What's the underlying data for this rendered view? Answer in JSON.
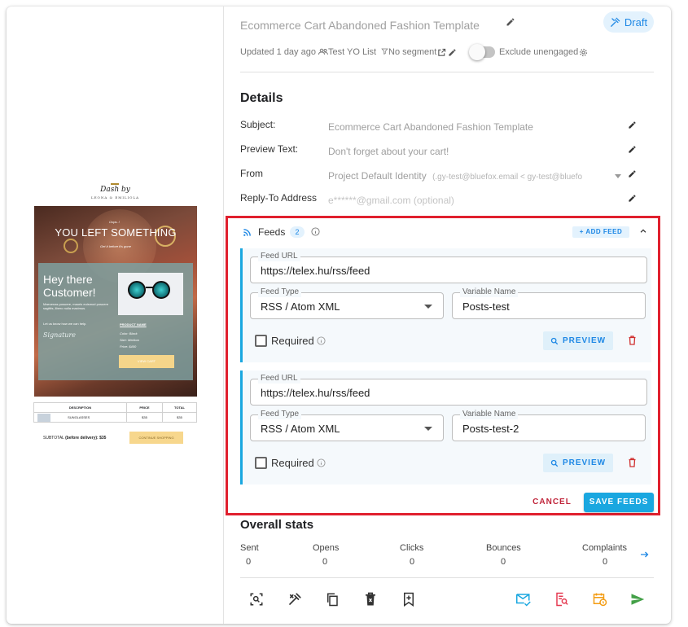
{
  "campaign": {
    "title": "Ecommerce Cart Abandoned Fashion Template",
    "status": "Draft",
    "updated": "Updated 1 day ago",
    "list": "Test YO List",
    "segment": "No segment",
    "exclude_label": "Exclude unengaged"
  },
  "details": {
    "heading": "Details",
    "subject_label": "Subject:",
    "subject_value": "Ecommerce Cart Abandoned Fashion Template",
    "preview_label": "Preview Text:",
    "preview_value": "Don't forget about your cart!",
    "from_label": "From",
    "from_value": "Project Default Identity",
    "from_sub": "(.gy-test@bluefox.email < gy-test@bluefo",
    "reply_label": "Reply-To Address",
    "reply_value": "e******@gmail.com (optional)"
  },
  "feeds": {
    "title": "Feeds",
    "count": "2",
    "add_label": "ADD FEED",
    "items": [
      {
        "url_label": "Feed URL",
        "url": "https://telex.hu/rss/feed",
        "type_label": "Feed Type",
        "type": "RSS / Atom XML",
        "var_label": "Variable Name",
        "var": "Posts-test",
        "required_label": "Required",
        "preview_label": "PREVIEW"
      },
      {
        "url_label": "Feed URL",
        "url": "https://telex.hu/rss/feed",
        "type_label": "Feed Type",
        "type": "RSS / Atom XML",
        "var_label": "Variable Name",
        "var": "Posts-test-2",
        "required_label": "Required",
        "preview_label": "PREVIEW"
      }
    ],
    "cancel_label": "CANCEL",
    "save_label": "SAVE FEEDS"
  },
  "stats": {
    "heading": "Overall stats",
    "items": [
      {
        "label": "Sent",
        "value": "0"
      },
      {
        "label": "Opens",
        "value": "0"
      },
      {
        "label": "Clicks",
        "value": "0"
      },
      {
        "label": "Bounces",
        "value": "0"
      },
      {
        "label": "Complaints",
        "value": "0"
      }
    ]
  },
  "email_preview": {
    "brand_line1": "Dash by",
    "brand_line2": "LEONA & EMILIOLA",
    "oops": "Oops..!",
    "headline": "YOU LEFT SOMETHING",
    "tagline": "Get it before it's gone",
    "greeting": "Hey there Customer!",
    "body": "Maecenas posuere, mauris euismod posuere sagittis, libero nulla maximus.",
    "letus": "Let us know how we can help.",
    "signature": "Signature",
    "product_name": "PRODUCT NAME",
    "color": "Color: Black",
    "size": "Size: Medium",
    "price": "Price: $400",
    "view_cart": "VIEW CART",
    "table_headers": [
      "DESCRIPTION",
      "PRICE",
      "TOTAL"
    ],
    "table_row": [
      "SUNGLASSES",
      "$35",
      "$35"
    ],
    "subtotal_label": "SUBTOTAL",
    "subtotal_note": "(before delivery)",
    "subtotal_value": ": $35",
    "continue": "CONTINUE SHOPPING"
  },
  "colors": {
    "accent": "#1aa7e0",
    "highlight_border": "#e0202e",
    "cancel": "#c0243a",
    "mail_icon": "#1aa7e0",
    "report_icon": "#e53950",
    "schedule_icon": "#f39c12",
    "send_icon": "#43a047"
  }
}
